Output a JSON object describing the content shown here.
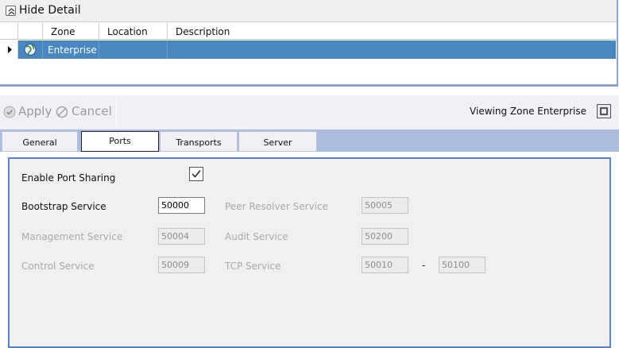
{
  "detail": {
    "hide_label": "Hide Detail",
    "columns": {
      "zone": "Zone",
      "location": "Location",
      "description": "Description"
    },
    "row": {
      "zone": "Enterprise",
      "location": "",
      "description": ""
    }
  },
  "toolbar": {
    "apply_label": "Apply",
    "cancel_label": "Cancel",
    "viewing_text": "Viewing Zone Enterprise"
  },
  "tabs": [
    {
      "label": "General",
      "active": false
    },
    {
      "label": "Ports",
      "active": true
    },
    {
      "label": "Transports",
      "active": false
    },
    {
      "label": "Server",
      "active": false
    }
  ],
  "ports": {
    "enable_sharing_label": "Enable Port Sharing",
    "enable_sharing_checked": true,
    "bootstrap": {
      "label": "Bootstrap Service",
      "value": "50000"
    },
    "peer_resolver": {
      "label": "Peer Resolver Service",
      "value": "50005"
    },
    "management": {
      "label": "Management Service",
      "value": "50004"
    },
    "audit": {
      "label": "Audit Service",
      "value": "50200"
    },
    "control": {
      "label": "Control Service",
      "value": "50009"
    },
    "tcp": {
      "label": "TCP Service",
      "from": "50010",
      "separator": "-",
      "to": "50100"
    }
  },
  "colors": {
    "selection": "#4a87c1",
    "tab_strip": "#aabce0",
    "panel_border": "#5a80c8"
  }
}
